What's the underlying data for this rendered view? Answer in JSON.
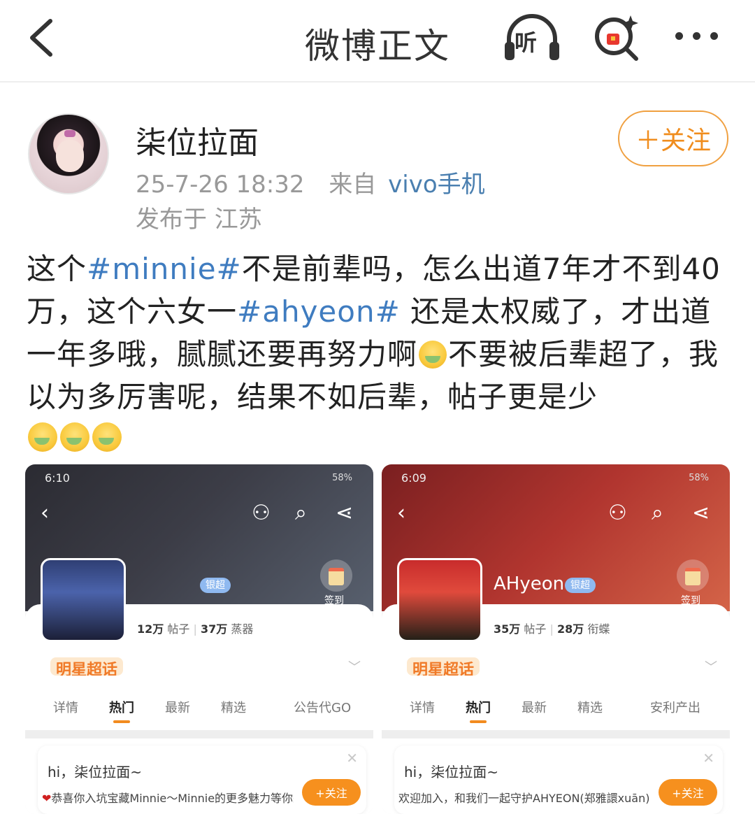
{
  "nav": {
    "title": "微博正文",
    "listen_label": "听"
  },
  "post": {
    "username": "柒位拉面",
    "timestamp": "25-7-26 18:32",
    "source_prefix": "来自",
    "device": "vivo手机",
    "location": "发布于 江苏",
    "follow_label": "＋关注",
    "text": {
      "p1": "这个",
      "tag1": "#minnie#",
      "p2": "不是前辈吗，怎么出道7年才不到40万，这个六女一",
      "tag2": "#ahyeon#",
      "p3": " 还是太权威了，才出道一年多哦，腻腻还要再努力啊",
      "p4": "不要被后辈超了，我以为多厉害呢，结果不如后辈，帖子更是少"
    },
    "emoji_name": "crying-face-emoji"
  },
  "screenshots": [
    {
      "time": "6:10",
      "battery": "58%",
      "name": "",
      "badge": "银超",
      "checkin": "签到",
      "posts_count": "12万",
      "posts_label": "帖子",
      "fans_count": "37万",
      "fans_label": "蒸器",
      "brand": "明星超话",
      "tabs": [
        "详情",
        "热门",
        "最新",
        "精选",
        "公告代GO"
      ],
      "notice_hi": "hi，柒位拉面~",
      "notice_msg": "恭喜你入坑宝藏Minnie～Minnie的更多魅力等你来发现！",
      "notice_follow": "+关注"
    },
    {
      "time": "6:09",
      "battery": "58%",
      "name": "AHyeon",
      "badge": "银超",
      "checkin": "签到",
      "posts_count": "35万",
      "posts_label": "帖子",
      "fans_count": "28万",
      "fans_label": "衔蝶",
      "brand": "明星超话",
      "tabs": [
        "详情",
        "热门",
        "最新",
        "精选",
        "安利产出"
      ],
      "notice_hi": "hi，柒位拉面~",
      "notice_msg": "欢迎加入，和我们一起守护AHYEON(郑雅譞xuān)吧！",
      "notice_follow": "+关注"
    }
  ],
  "colors": {
    "accent_orange": "#f08d1e",
    "link_blue": "#3f7cc0"
  }
}
